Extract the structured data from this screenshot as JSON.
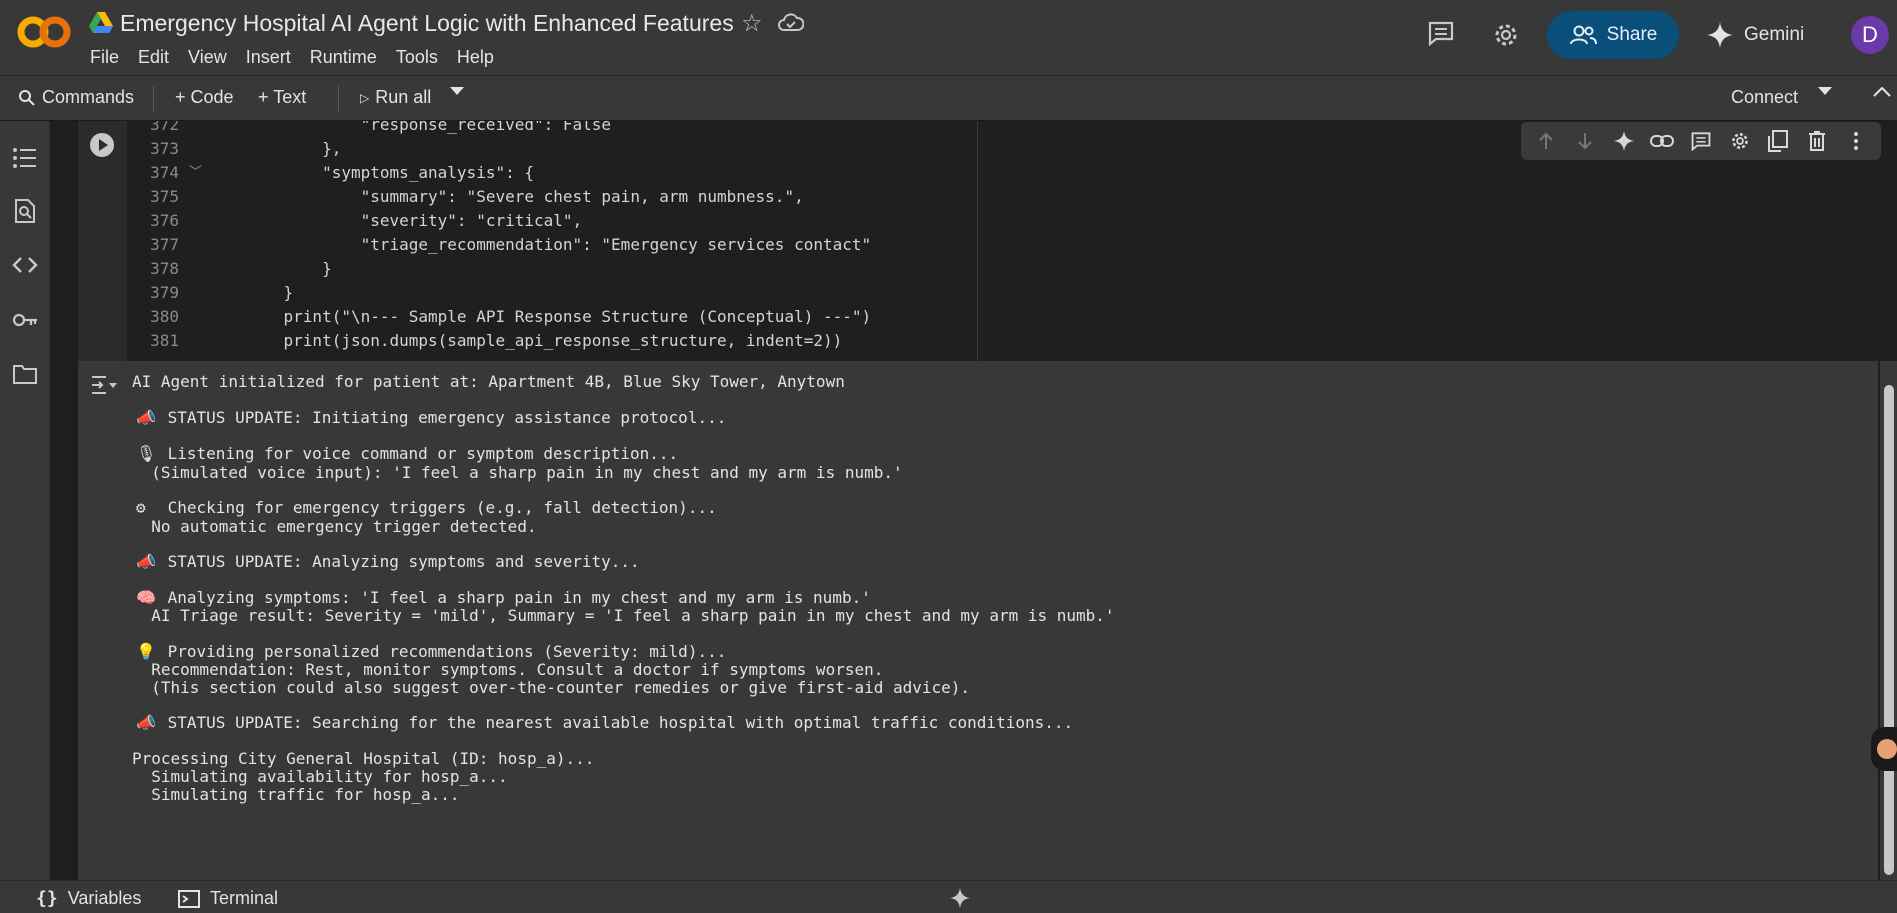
{
  "header": {
    "title": "Emergency Hospital AI Agent Logic with Enhanced Features",
    "menu": [
      "File",
      "Edit",
      "View",
      "Insert",
      "Runtime",
      "Tools",
      "Help"
    ],
    "share_label": "Share",
    "gemini_label": "Gemini",
    "avatar_letter": "D"
  },
  "toolbar": {
    "commands_label": "Commands",
    "code_label": "+ Code",
    "text_label": "+ Text",
    "run_all_label": "Run all",
    "connect_label": "Connect"
  },
  "code_cell": {
    "lines": [
      {
        "num": "372",
        "text": "            \"response_received\": False"
      },
      {
        "num": "373",
        "text": "        },"
      },
      {
        "num": "374",
        "text": "        \"symptoms_analysis\": {"
      },
      {
        "num": "375",
        "text": "            \"summary\": \"Severe chest pain, arm numbness.\","
      },
      {
        "num": "376",
        "text": "            \"severity\": \"critical\","
      },
      {
        "num": "377",
        "text": "            \"triage_recommendation\": \"Emergency services contact\""
      },
      {
        "num": "378",
        "text": "        }"
      },
      {
        "num": "379",
        "text": "    }"
      },
      {
        "num": "380",
        "text": "    print(\"\\n--- Sample API Response Structure (Conceptual) ---\")"
      },
      {
        "num": "381",
        "text": "    print(json.dumps(sample_api_response_structure, indent=2))"
      }
    ]
  },
  "output": {
    "lines": [
      {
        "emoji": "",
        "text": "AI Agent initialized for patient at: Apartment 4B, Blue Sky Tower, Anytown"
      },
      {
        "emoji": "📣",
        "text": "STATUS UPDATE: Initiating emergency assistance protocol..."
      },
      {
        "emoji": "🎙",
        "text": "Listening for voice command or symptom description..."
      },
      {
        "emoji": "",
        "text": "  (Simulated voice input): 'I feel a sharp pain in my chest and my arm is numb.'"
      },
      {
        "emoji": "⚙",
        "text": "Checking for emergency triggers (e.g., fall detection)..."
      },
      {
        "emoji": "",
        "text": "  No automatic emergency trigger detected."
      },
      {
        "emoji": "📣",
        "text": "STATUS UPDATE: Analyzing symptoms and severity..."
      },
      {
        "emoji": "🧠",
        "text": "Analyzing symptoms: 'I feel a sharp pain in my chest and my arm is numb.'"
      },
      {
        "emoji": "",
        "text": "  AI Triage result: Severity = 'mild', Summary = 'I feel a sharp pain in my chest and my arm is numb.'"
      },
      {
        "emoji": "💡",
        "text": "Providing personalized recommendations (Severity: mild)..."
      },
      {
        "emoji": "",
        "text": "  Recommendation: Rest, monitor symptoms. Consult a doctor if symptoms worsen."
      },
      {
        "emoji": "",
        "text": "  (This section could also suggest over-the-counter remedies or give first-aid advice)."
      },
      {
        "emoji": "📣",
        "text": "STATUS UPDATE: Searching for the nearest available hospital with optimal traffic conditions..."
      },
      {
        "emoji": "",
        "text": "Processing City General Hospital (ID: hosp_a)..."
      },
      {
        "emoji": "",
        "text": "  Simulating availability for hosp_a..."
      },
      {
        "emoji": "",
        "text": "  Simulating traffic for hosp_a..."
      }
    ]
  },
  "bottombar": {
    "variables_label": "Variables",
    "terminal_label": "Terminal"
  }
}
